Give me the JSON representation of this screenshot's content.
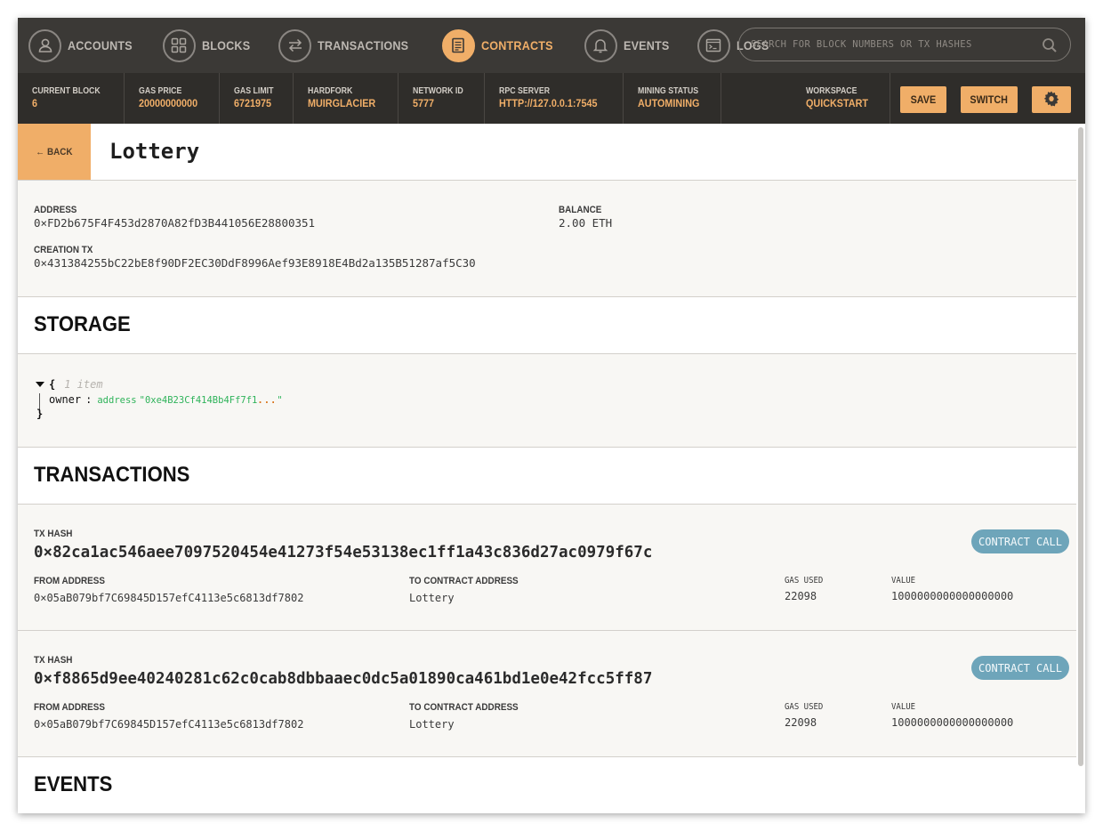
{
  "nav": {
    "items": [
      {
        "label": "ACCOUNTS",
        "icon": "user-icon"
      },
      {
        "label": "BLOCKS",
        "icon": "grid-icon"
      },
      {
        "label": "TRANSACTIONS",
        "icon": "swap-arrows-icon"
      },
      {
        "label": "CONTRACTS",
        "icon": "document-icon",
        "active": true
      },
      {
        "label": "EVENTS",
        "icon": "bell-icon"
      },
      {
        "label": "LOGS",
        "icon": "terminal-icon"
      }
    ],
    "search_placeholder": "SEARCH FOR BLOCK NUMBERS OR TX HASHES"
  },
  "status": {
    "current_block": {
      "label": "CURRENT BLOCK",
      "value": "6"
    },
    "gas_price": {
      "label": "GAS PRICE",
      "value": "20000000000"
    },
    "gas_limit": {
      "label": "GAS LIMIT",
      "value": "6721975"
    },
    "hardfork": {
      "label": "HARDFORK",
      "value": "MUIRGLACIER"
    },
    "network_id": {
      "label": "NETWORK ID",
      "value": "5777"
    },
    "rpc_server": {
      "label": "RPC SERVER",
      "value": "HTTP://127.0.0.1:7545"
    },
    "mining_status": {
      "label": "MINING STATUS",
      "value": "AUTOMINING"
    },
    "workspace": {
      "label": "WORKSPACE",
      "value": "QUICKSTART"
    },
    "save_label": "SAVE",
    "switch_label": "SWITCH"
  },
  "contract": {
    "back_label": "← BACK",
    "name": "Lottery",
    "address_label": "ADDRESS",
    "address": "0×FD2b675F4F453d2870A82fD3B441056E28800351",
    "balance_label": "BALANCE",
    "balance": "2.00 ETH",
    "creation_tx_label": "CREATION TX",
    "creation_tx": "0×431384255bC22bE8f90DF2EC30DdF8996Aef93E8918E4Bd2a135B51287af5C30"
  },
  "storage": {
    "heading": "STORAGE",
    "open_brace": "{",
    "close_brace": "}",
    "count": "1 item",
    "key": "owner",
    "colon": ":",
    "type": "address",
    "value": "\"0xe4B23Cf414Bb4Ff7f1",
    "ellipsis": "...",
    "value_end": "\""
  },
  "transactions": {
    "heading": "TRANSACTIONS",
    "items": [
      {
        "hash_label": "TX HASH",
        "hash": "0×82ca1ac546aee7097520454e41273f54e53138ec1ff1a43c836d27ac0979f67c",
        "badge": "CONTRACT CALL",
        "from_label": "FROM ADDRESS",
        "from": "0×05aB079bf7C69845D157efC4113e5c6813df7802",
        "to_label": "TO CONTRACT ADDRESS",
        "to": "Lottery",
        "gas_label": "GAS USED",
        "gas": "22098",
        "value_label": "VALUE",
        "value": "1000000000000000000"
      },
      {
        "hash_label": "TX HASH",
        "hash": "0×f8865d9ee40240281c62c0cab8dbbaaec0dc5a01890ca461bd1e0e42fcc5ff87",
        "badge": "CONTRACT CALL",
        "from_label": "FROM ADDRESS",
        "from": "0×05aB079bf7C69845D157efC4113e5c6813df7802",
        "to_label": "TO CONTRACT ADDRESS",
        "to": "Lottery",
        "gas_label": "GAS USED",
        "gas": "22098",
        "value_label": "VALUE",
        "value": "1000000000000000000"
      }
    ]
  },
  "events": {
    "heading": "EVENTS"
  },
  "colors": {
    "accent": "#f0ae68",
    "nav_bg": "#3b3936",
    "status_bg": "#2f2d2a",
    "badge": "#6ea5ba"
  }
}
